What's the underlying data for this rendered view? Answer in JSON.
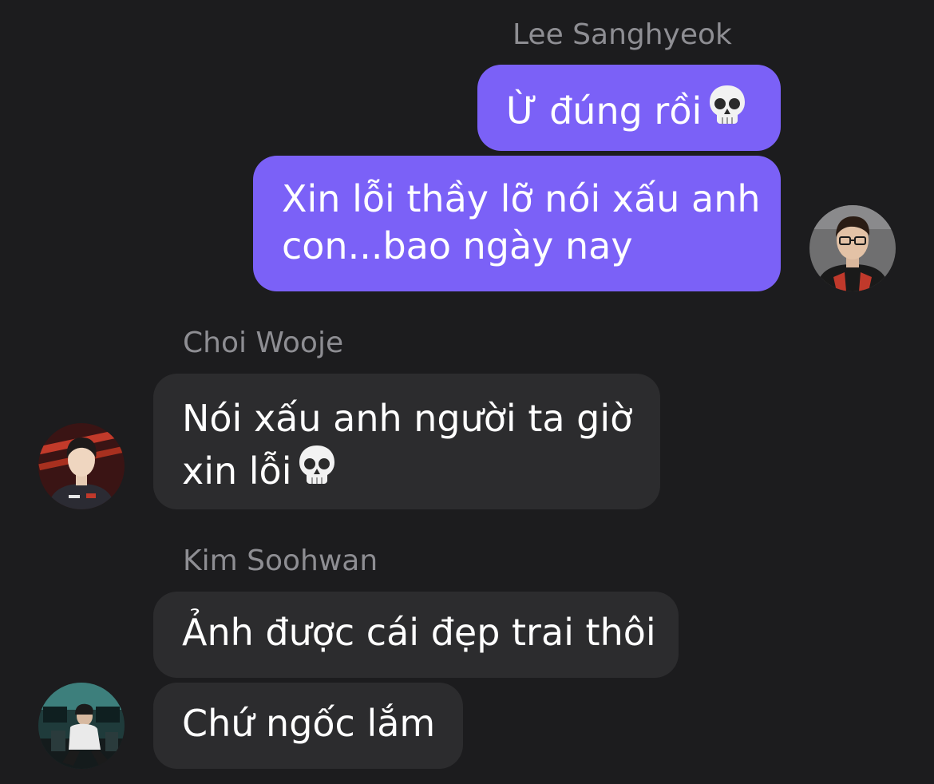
{
  "conversation": {
    "groups": [
      {
        "sender": "Lee Sanghyeok",
        "direction": "outgoing",
        "messages": [
          {
            "text": "Ừ đúng rồi",
            "emoji": "skull-icon"
          },
          {
            "lines": [
              "Xin lỗi thầy lỡ nói xấu anh",
              "con...bao ngày nay"
            ]
          }
        ]
      },
      {
        "sender": "Choi Wooje",
        "direction": "incoming",
        "messages": [
          {
            "lines": [
              "Nói xấu anh người ta giờ",
              "xin lỗi"
            ],
            "emoji": "skull-icon"
          }
        ]
      },
      {
        "sender": "Kim Soohwan",
        "direction": "incoming",
        "messages": [
          {
            "text": "Ảnh được cái đẹp trai thôi"
          },
          {
            "text": "Chứ ngốc lắm"
          }
        ]
      }
    ]
  },
  "colors": {
    "background": "#1c1c1e",
    "outgoing_bubble": "#7b61f7",
    "incoming_bubble": "#2c2c2e",
    "sender_name": "#8e8e93",
    "text": "#ffffff"
  }
}
